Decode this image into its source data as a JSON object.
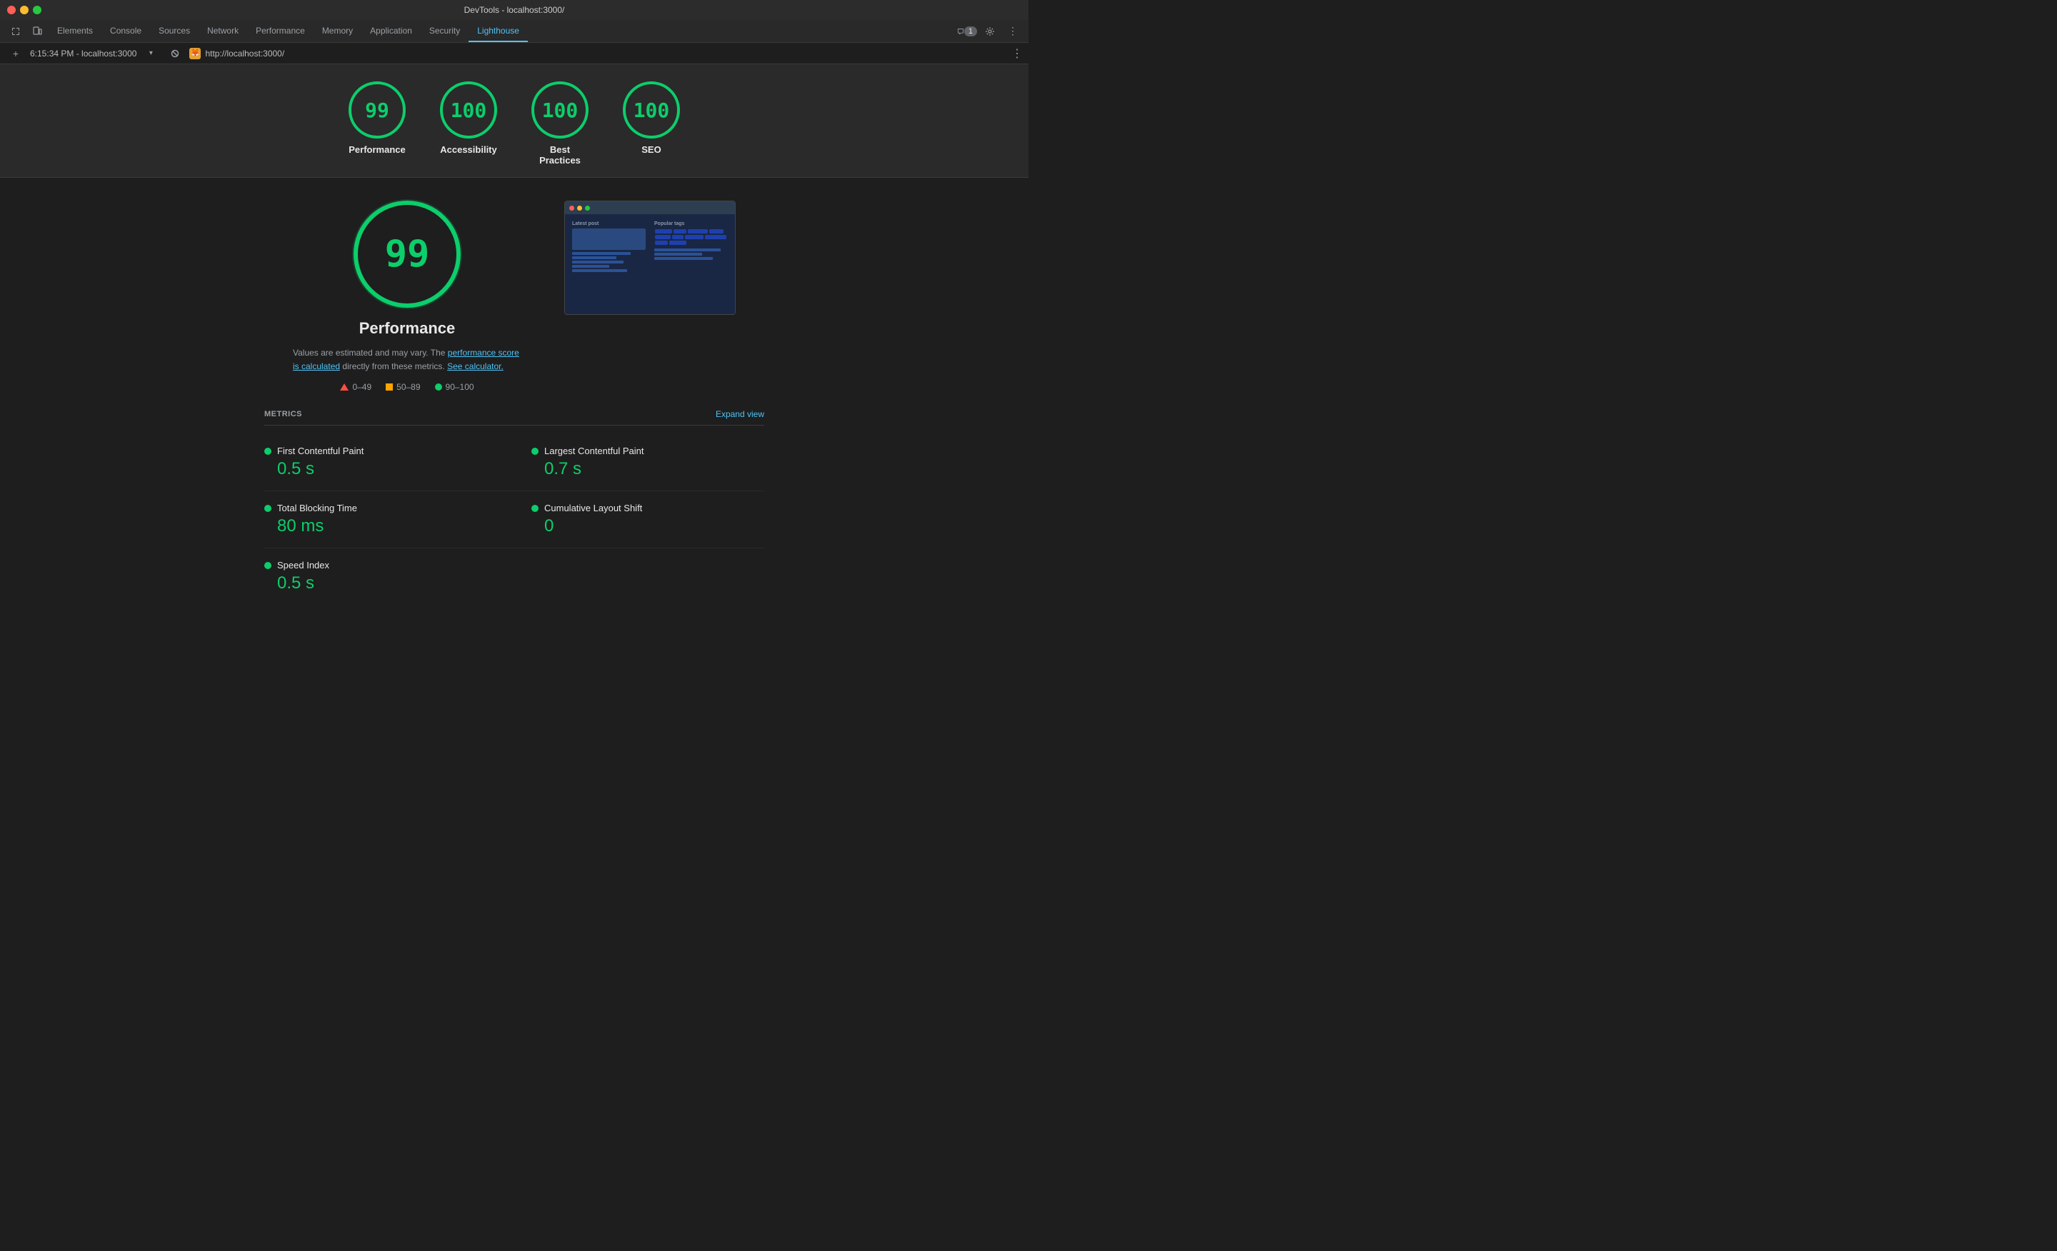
{
  "titleBar": {
    "title": "DevTools - localhost:3000/"
  },
  "tabs": [
    {
      "label": "Elements",
      "active": false
    },
    {
      "label": "Console",
      "active": false
    },
    {
      "label": "Sources",
      "active": false
    },
    {
      "label": "Network",
      "active": false
    },
    {
      "label": "Performance",
      "active": false
    },
    {
      "label": "Memory",
      "active": false
    },
    {
      "label": "Application",
      "active": false
    },
    {
      "label": "Security",
      "active": false
    },
    {
      "label": "Lighthouse",
      "active": true
    }
  ],
  "urlBar": {
    "url": "http://localhost:3000/",
    "time": "6:15:34 PM - localhost:3000"
  },
  "toolbar": {
    "badgeCount": "1"
  },
  "scores": [
    {
      "value": "99",
      "label": "Performance"
    },
    {
      "value": "100",
      "label": "Accessibility"
    },
    {
      "value": "100",
      "label": "Best Practices"
    },
    {
      "value": "100",
      "label": "SEO"
    }
  ],
  "performance": {
    "score": "99",
    "title": "Performance",
    "description": "Values are estimated and may vary. The",
    "link1": "performance score is calculated",
    "descMid": "directly from these metrics.",
    "link2": "See calculator.",
    "metricsTitle": "METRICS",
    "expandView": "Expand view"
  },
  "legend": [
    {
      "range": "0–49",
      "type": "red"
    },
    {
      "range": "50–89",
      "type": "orange"
    },
    {
      "range": "90–100",
      "type": "green"
    }
  ],
  "metrics": [
    {
      "name": "First Contentful Paint",
      "value": "0.5 s",
      "color": "green"
    },
    {
      "name": "Largest Contentful Paint",
      "value": "0.7 s",
      "color": "green"
    },
    {
      "name": "Total Blocking Time",
      "value": "80 ms",
      "color": "green"
    },
    {
      "name": "Cumulative Layout Shift",
      "value": "0",
      "color": "green"
    },
    {
      "name": "Speed Index",
      "value": "0.5 s",
      "color": "green"
    }
  ]
}
